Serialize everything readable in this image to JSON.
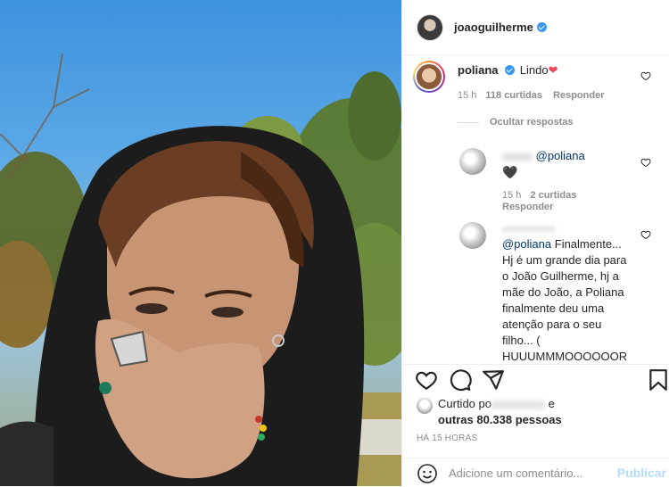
{
  "post": {
    "author": "joaoguilherme",
    "verified": true
  },
  "comments": [
    {
      "user": "poliana",
      "verified": true,
      "text": "Lindo",
      "emoji": "❤",
      "time": "15 h",
      "likes": "118 curtidas",
      "reply": "Responder"
    }
  ],
  "hide_replies": "Ocultar respostas",
  "replies": [
    {
      "mention": "@poliana",
      "emoji": "🖤",
      "time": "15 h",
      "likes": "2 curtidas",
      "reply": "Responder"
    },
    {
      "mention": "@poliana",
      "text_lines": [
        "Finalmente...",
        "Hj é um grande dia para",
        "o João Guilherme, hj a",
        "mãe do João, a Poliana",
        "finalmente deu uma",
        "atenção para o seu",
        "filho... (",
        "HUUUMMMOOOOOOR"
      ]
    }
  ],
  "liked_by": {
    "prefix": "Curtido po",
    "suffix": " e",
    "others": "outras 80.338 pessoas"
  },
  "time_ago": "HÁ 15 HORAS",
  "add_comment": {
    "placeholder": "Adicione um comentário...",
    "publish": "Publicar"
  },
  "colors": {
    "accent": "#3897f0",
    "heart_red": "#ed4956",
    "publish_disabled": "#b3dbff",
    "mention": "#00376b"
  },
  "icons": [
    "heart-icon",
    "comment-icon",
    "share-icon",
    "bookmark-icon",
    "emoji-icon",
    "verified-icon"
  ]
}
